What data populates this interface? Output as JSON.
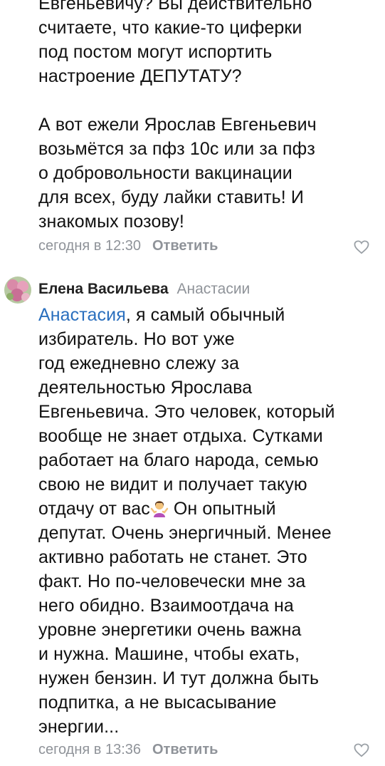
{
  "comment1": {
    "lines": "Евгеньевичу? Вы действительно\nсчитаете,  что какие-то циферки\nпод постом могут испортить\nнастроение ДЕПУТАТУ?\n\nА вот ежели Ярослав Евгеньевич\nвозьмётся за пфз 10с или за пфз\nо добровольности вакцинации\nдля всех, буду лайки ставить! И\nзнакомых позову!",
    "time": "сегодня в 12:30",
    "reply_label": "Ответить"
  },
  "comment2": {
    "author": "Елена Васильева",
    "reply_to": "Анастасии",
    "mention": "Анастасия",
    "text_part1": ", я самый обычный\nизбиратель. Но вот уже\nгод ежедневно слежу за\nдеятельностью Ярослава\nЕвгеньевича. Это человек, который\nвообще не знает отдыха. Сутками\nработает на благо народа, семью\nсвою не видит и получает  такую\nотдачу от вас",
    "text_part2": " Он опытный\nдепутат. Очень энергичный. Менее\nактивно работать не станет. Это\nфакт. Но по-человечески мне за\nнего обидно. Взаимоотдача на\nуровне энергетики очень важна\nи нужна. Машине, чтобы ехать,\nнужен бензин. И тут должна быть\nподпитка, а не высасывание\nэнергии...",
    "time": "сегодня в 13:36",
    "reply_label": "Ответить"
  },
  "icons": {
    "like": "heart-outline-icon",
    "emoji": "person-shrugging-emoji",
    "avatar": "flowers-avatar"
  }
}
